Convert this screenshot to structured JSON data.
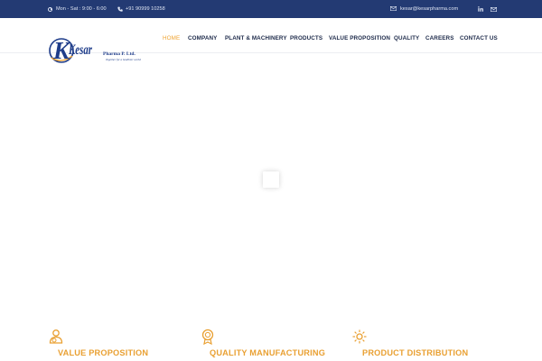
{
  "topbar": {
    "hours": "Mon - Sat : 9:00 - 6:00",
    "phone": "+91 90999 10258",
    "email": "kesar@kesarpharma.com",
    "icons": [
      "clock-icon",
      "phone-icon",
      "mail-icon",
      "linkedin-icon",
      "envelope-icon"
    ]
  },
  "logo": {
    "wordmark": "Kesar",
    "company": "Pharma P. Ltd.",
    "tagline": "Together for a healthier world"
  },
  "nav": {
    "items": [
      "HOME",
      "COMPANY",
      "PLANT & MACHINERY",
      "PRODUCTS",
      "VALUE PROPOSITION",
      "QUALITY",
      "CAREERS",
      "CONTACT US"
    ],
    "active": "HOME"
  },
  "features": [
    {
      "title": "VALUE PROPOSITION",
      "icon": "person-icon"
    },
    {
      "title": "QUALITY MANUFACTURING",
      "icon": "award-icon"
    },
    {
      "title": "PRODUCT DISTRIBUTION",
      "icon": "sun-icon"
    }
  ],
  "colors": {
    "topbar": "#233a73",
    "accent": "#f0a330",
    "nav_text": "#1d2a4a",
    "logo_blue": "#1f3d8a"
  }
}
